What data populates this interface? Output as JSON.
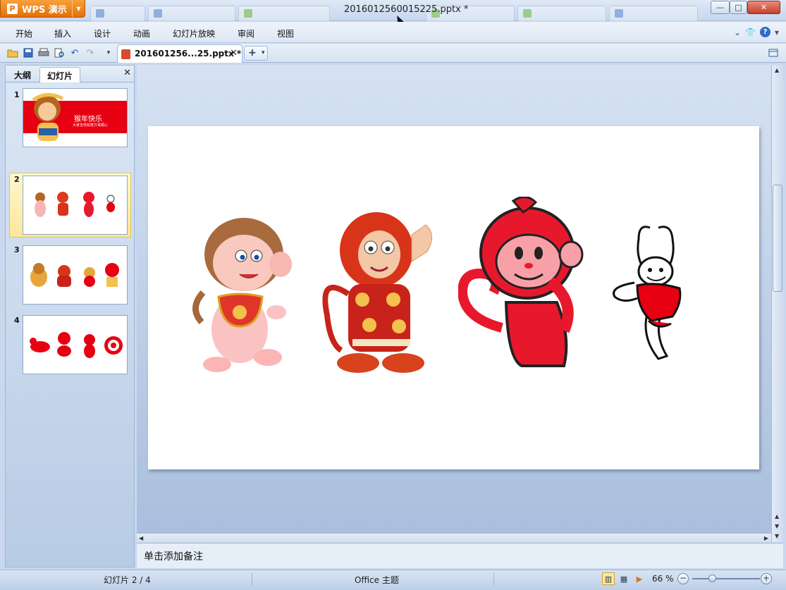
{
  "window": {
    "app_button_label": "WPS 演示",
    "app_logo_glyph": "P",
    "document_title": "2016012560015225.pptx *",
    "minimize_glyph": "—",
    "maximize_glyph": "□",
    "close_glyph": "✕"
  },
  "menu": {
    "items": [
      "开始",
      "插入",
      "设计",
      "动画",
      "幻灯片放映",
      "审阅",
      "视图"
    ],
    "help_glyph": "?"
  },
  "toolbar": {
    "doc_tab_label": "201601256...25.pptx *",
    "doc_tab_close": "✕",
    "new_tab_glyph": "+",
    "new_tab_arrow": "▾"
  },
  "left_panel": {
    "tab_outline": "大纲",
    "tab_slides": "幻灯片",
    "close_glyph": "✕",
    "selected_slide": 2,
    "thumbnails": [
      {
        "number": "1",
        "caption": "猴年快乐",
        "subcaption": "大家吉祥如意万事顺心"
      },
      {
        "number": "2"
      },
      {
        "number": "3"
      },
      {
        "number": "4"
      }
    ]
  },
  "notes": {
    "placeholder": "单击添加备注"
  },
  "status": {
    "slide_count": "幻灯片 2 / 4",
    "theme": "Office 主题",
    "zoom": "66 %",
    "zoom_out_glyph": "−",
    "zoom_in_glyph": "+",
    "zoom_level": 0.66
  },
  "colors": {
    "accent_orange": "#e36f06",
    "slide_red": "#e60012",
    "selection_yellow": "#fde79a"
  },
  "icons": [
    "open-folder-icon",
    "save-icon",
    "print-icon",
    "print-preview-icon",
    "undo-icon",
    "redo-icon",
    "customize-toolbar-icon",
    "ppt-file-icon",
    "close-icon",
    "plus-icon",
    "shirt-skin-icon",
    "help-icon",
    "chevron-down-icon",
    "normal-view-icon",
    "slide-sorter-icon",
    "slideshow-icon"
  ]
}
